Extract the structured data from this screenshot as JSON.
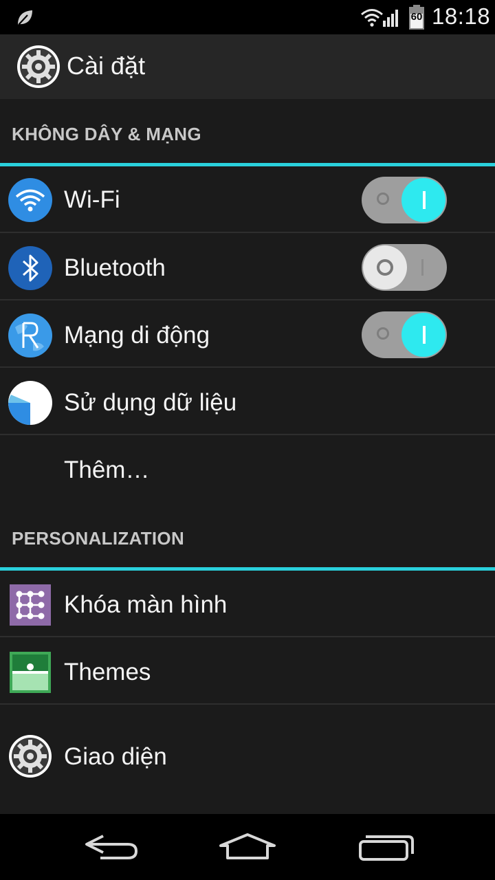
{
  "status_bar": {
    "time": "18:18",
    "battery_level": "60",
    "icons": [
      "leaf-icon",
      "wifi-icon",
      "signal-icon",
      "battery-icon"
    ]
  },
  "action_bar": {
    "title": "Cài đặt",
    "icon": "settings-gear-icon"
  },
  "sections": [
    {
      "header": "KHÔNG DÂY & MẠNG",
      "items": [
        {
          "label": "Wi-Fi",
          "icon": "wifi-icon",
          "toggle": "on"
        },
        {
          "label": "Bluetooth",
          "icon": "bluetooth-icon",
          "toggle": "off"
        },
        {
          "label": "Mạng di động",
          "icon": "mobile-network-icon",
          "toggle": "on"
        },
        {
          "label": "Sử dụng dữ liệu",
          "icon": "data-usage-icon"
        },
        {
          "label": "Thêm…"
        }
      ]
    },
    {
      "header": "PERSONALIZATION",
      "items": [
        {
          "label": "Khóa màn hình",
          "icon": "lock-screen-icon"
        },
        {
          "label": "Themes",
          "icon": "themes-icon"
        },
        {
          "label": "Giao diện",
          "icon": "display-gear-icon"
        }
      ]
    }
  ],
  "nav_bar": {
    "icons": [
      "back-icon",
      "home-icon",
      "recent-apps-icon"
    ]
  },
  "colors": {
    "accent": "#2ad0dc",
    "toggle_on": "#2ee9ef",
    "background": "#1b1b1b",
    "action_bar": "#262626"
  }
}
